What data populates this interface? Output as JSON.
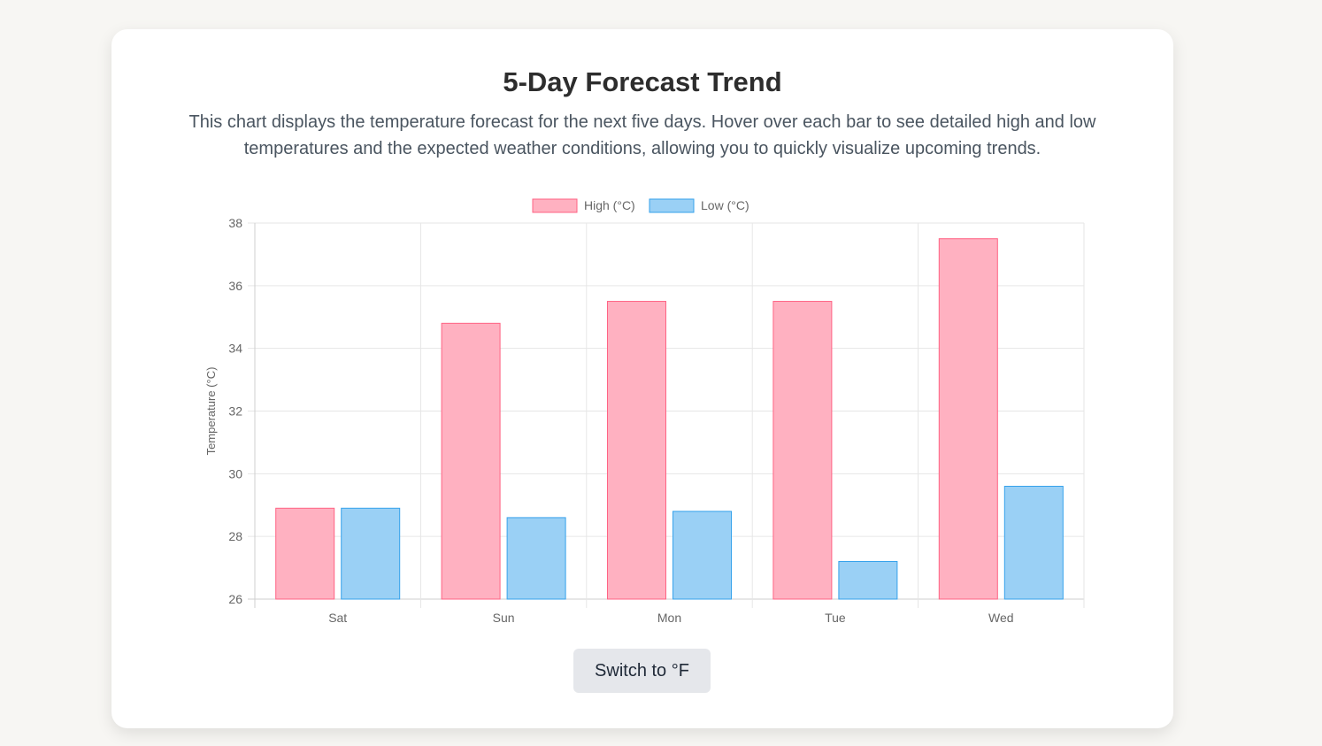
{
  "page": {
    "title": "5-Day Forecast Trend",
    "description": "This chart displays the temperature forecast for the next five days. Hover over each bar to see detailed high and low temperatures and the expected weather conditions, allowing you to quickly visualize upcoming trends.",
    "toggle_label": "Switch to °F"
  },
  "chart_data": {
    "type": "bar",
    "categories": [
      "Sat",
      "Sun",
      "Mon",
      "Tue",
      "Wed"
    ],
    "series": [
      {
        "name": "High (°C)",
        "values": [
          28.9,
          34.8,
          35.5,
          35.5,
          37.5
        ],
        "color": "#ffb1c1",
        "border": "#ff6384"
      },
      {
        "name": "Low (°C)",
        "values": [
          28.9,
          28.6,
          28.8,
          27.2,
          29.6
        ],
        "color": "#9ad0f5",
        "border": "#36a2eb"
      }
    ],
    "ylabel": "Temperature (°C)",
    "xlabel": "",
    "ylim": [
      26,
      38
    ],
    "yticks": [
      26,
      28,
      30,
      32,
      34,
      36,
      38
    ],
    "grid": true,
    "legend": "top"
  }
}
